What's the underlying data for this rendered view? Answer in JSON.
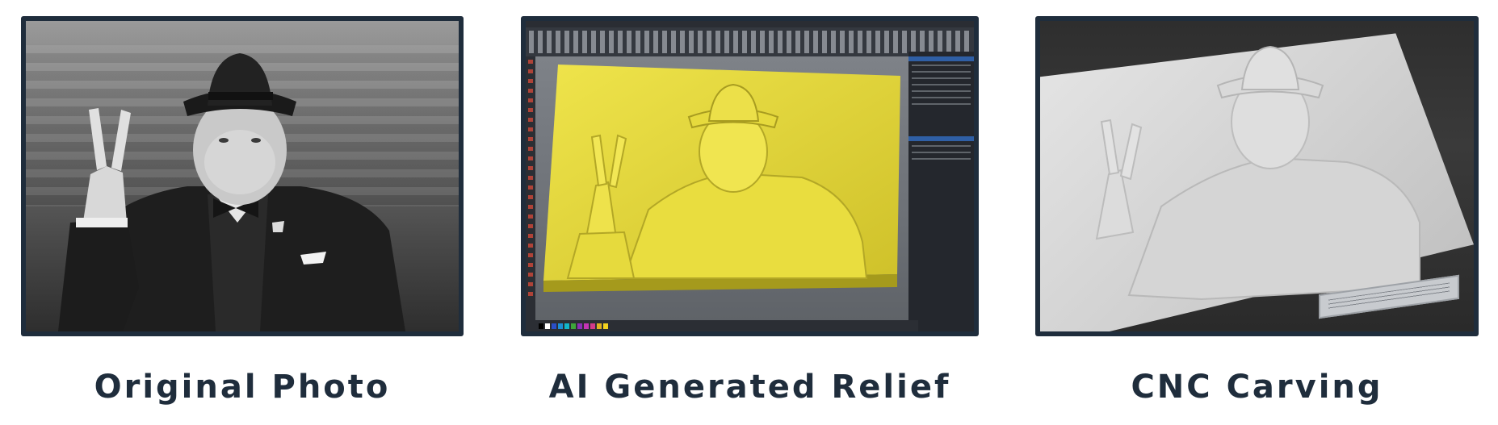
{
  "captions": {
    "original": "Original Photo",
    "relief": "AI Generated Relief",
    "carving": "CNC Carving"
  },
  "colors": {
    "frame": "#1f2d3c",
    "caption_text": "#1f2d3c",
    "relief_yellow": "#e3d83a",
    "viewport_gray": "#6f7378",
    "carving_white": "#dcdcdc"
  },
  "palette_swatches": [
    "#000000",
    "#ffffff",
    "#2a4fc9",
    "#1b8fd6",
    "#11b6c9",
    "#3ea53a",
    "#8d2fb7",
    "#c534b4",
    "#d53a89",
    "#e0b220",
    "#f3d21f"
  ]
}
